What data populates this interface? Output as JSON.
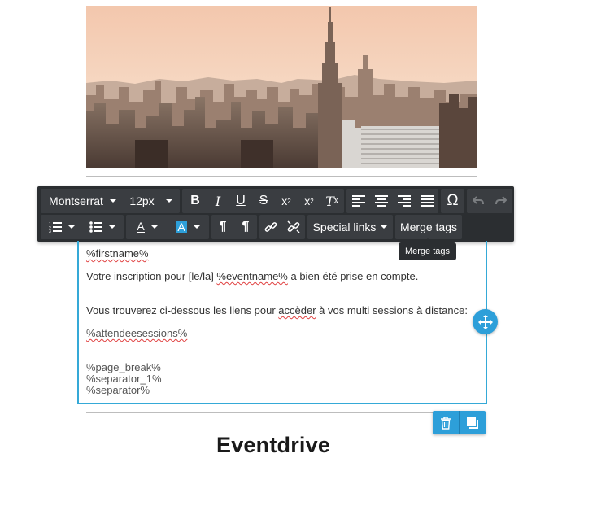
{
  "toolbar": {
    "font_family": "Montserrat",
    "font_size": "12px",
    "special_links_label": "Special links",
    "merge_tags_label": "Merge tags",
    "omega_symbol": "Ω",
    "icons": [
      "bold-icon",
      "italic-icon",
      "underline-icon",
      "strikethrough-icon",
      "superscript-icon",
      "subscript-icon",
      "clear-format-icon",
      "align-left-icon",
      "align-center-icon",
      "align-right-icon",
      "align-justify-icon",
      "special-char-icon",
      "undo-icon",
      "redo-icon",
      "ordered-list-icon",
      "bullet-list-icon",
      "font-color-icon",
      "background-color-icon",
      "ltr-icon",
      "rtl-icon",
      "link-icon",
      "unlink-icon"
    ]
  },
  "tooltip": {
    "text": "Merge tags"
  },
  "editor": {
    "firstname": "%firstname%",
    "line1_prefix": "Votre inscription pour [le/la] ",
    "line1_tag": "%eventname%",
    "line1_suffix": " a bien été prise en compte.",
    "line2_prefix": "Vous trouverez ci-dessous les liens pour ",
    "line2_word": "accèder",
    "line2_suffix": " à vos multi sessions à distance:",
    "attendeesessions": "%attendeesessions%",
    "page_break": "%page_break%",
    "separator_1": "%separator_1%",
    "separator": "%separator%"
  },
  "brand": {
    "name": "Eventdrive"
  },
  "colors": {
    "toolbar_bg": "#2b2e31",
    "accent": "#2d9fd9",
    "editor_border": "#35a9d7"
  }
}
